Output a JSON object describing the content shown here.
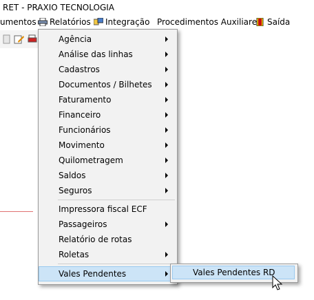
{
  "window": {
    "title": "RET - PRAXIO TECNOLOGIA"
  },
  "menubar": {
    "items": [
      {
        "label": "umentos"
      },
      {
        "label": "Relatórios",
        "icon": "printer-icon"
      },
      {
        "label": "Integração",
        "icon": "integration-icon"
      },
      {
        "label": "Procedimentos Auxiliares"
      },
      {
        "label": "Saída",
        "icon": "exit-door-icon"
      }
    ]
  },
  "dropdown": {
    "items": [
      {
        "label": "Agência",
        "submenu": true
      },
      {
        "label": "Análise das linhas",
        "submenu": true
      },
      {
        "label": "Cadastros",
        "submenu": true
      },
      {
        "label": "Documentos / Bilhetes",
        "submenu": true
      },
      {
        "label": "Faturamento",
        "submenu": true
      },
      {
        "label": "Financeiro",
        "submenu": true
      },
      {
        "label": "Funcionários",
        "submenu": true
      },
      {
        "label": "Movimento",
        "submenu": true
      },
      {
        "label": "Quilometragem",
        "submenu": true
      },
      {
        "label": "Saldos",
        "submenu": true
      },
      {
        "label": "Seguros",
        "submenu": true
      },
      {
        "label": "Impressora fiscal ECF",
        "submenu": false
      },
      {
        "label": "Passageiros",
        "submenu": true
      },
      {
        "label": "Relatório de rotas",
        "submenu": false
      },
      {
        "label": "Roletas",
        "submenu": true
      },
      {
        "label": "Vales Pendentes",
        "submenu": true,
        "active": true
      }
    ]
  },
  "submenu": {
    "items": [
      {
        "label": "Vales Pendentes RD"
      }
    ]
  },
  "colors": {
    "highlight": "#cce4f7",
    "highlight_border": "#99c9ef",
    "menu_bg": "#f2f2f2"
  }
}
